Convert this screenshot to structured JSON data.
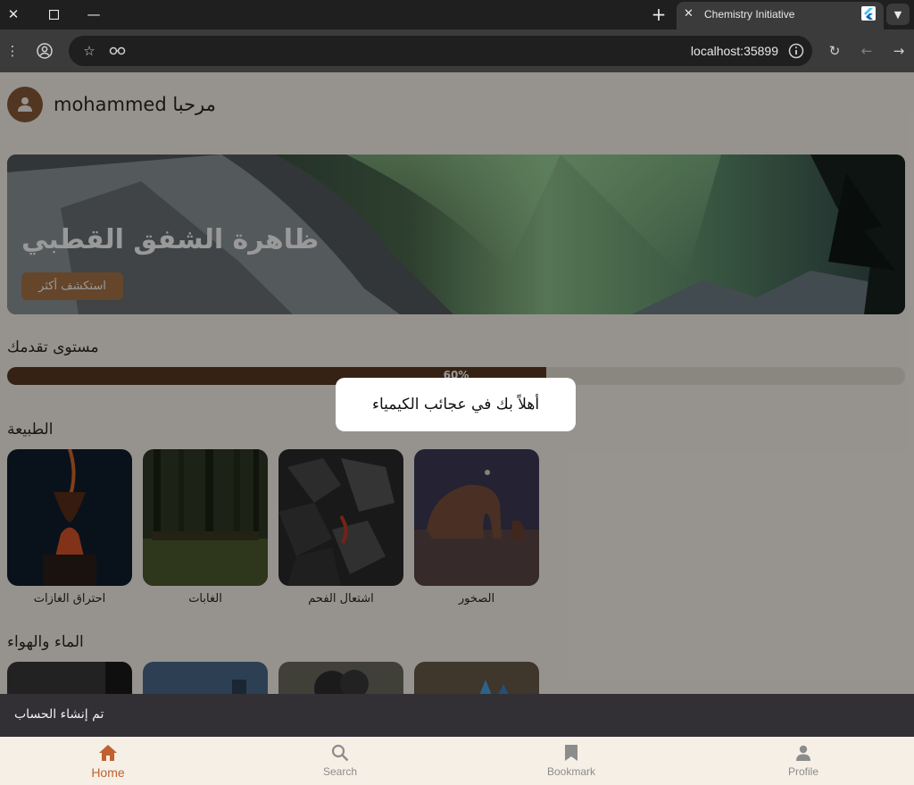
{
  "browser": {
    "tab_title": "Chemistry Initiative",
    "url": "localhost:35899"
  },
  "header": {
    "greeting": "مرحبا mohammed"
  },
  "hero": {
    "title": "ظاهرة الشفق القطبي",
    "button_label": "استكشف أكثر"
  },
  "progress": {
    "title": "مستوى تقدمك",
    "value": 0.6,
    "label": "60%"
  },
  "sections": [
    {
      "title": "الطبيعة",
      "items": [
        {
          "label": "الصخور",
          "icon": "rock-arch-image"
        },
        {
          "label": "اشتعال الفحم",
          "icon": "coal-image"
        },
        {
          "label": "الغابات",
          "icon": "forest-image"
        },
        {
          "label": "احتراق الغازات",
          "icon": "gas-burning-image"
        }
      ]
    },
    {
      "title": "الماء والهواء",
      "items": []
    }
  ],
  "toast": "أهلاً بك في عجائب الكيمياء",
  "snackbar": "تم إنشاء الحساب",
  "bottom_nav": [
    {
      "label": "Home",
      "icon": "home-icon",
      "active": true
    },
    {
      "label": "Search",
      "icon": "search-icon",
      "active": false
    },
    {
      "label": "Bookmark",
      "icon": "bookmark-icon",
      "active": false
    },
    {
      "label": "Profile",
      "icon": "profile-icon",
      "active": false
    }
  ],
  "colors": {
    "accent": "#c0622e",
    "brown": "#8a5a37",
    "progress_fill": "#5a3a22",
    "app_bg": "#fbf6ee"
  }
}
